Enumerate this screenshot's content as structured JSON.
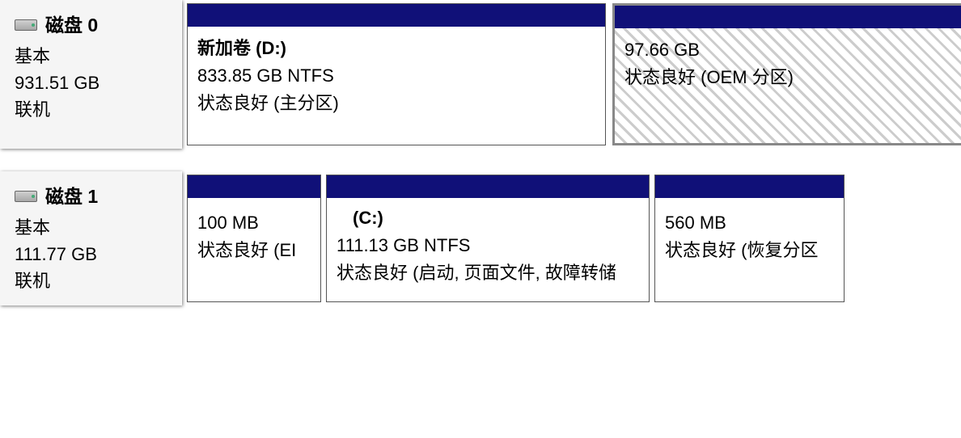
{
  "disks": [
    {
      "title": "磁盘 0",
      "type": "基本",
      "capacity": "931.51 GB",
      "status": "联机",
      "partitions": [
        {
          "name": "新加卷  (D:)",
          "size_fs": "833.85 GB NTFS",
          "status": "状态良好 (主分区)",
          "hatched": false
        },
        {
          "name": "",
          "size_fs": "97.66 GB",
          "status": "状态良好 (OEM 分区)",
          "hatched": true
        }
      ]
    },
    {
      "title": "磁盘 1",
      "type": "基本",
      "capacity": "111.77 GB",
      "status": "联机",
      "partitions": [
        {
          "name": "",
          "size_fs": "100 MB",
          "status": "状态良好 (EI",
          "hatched": false
        },
        {
          "name": "(C:)",
          "size_fs": "111.13 GB NTFS",
          "status": "状态良好 (启动, 页面文件, 故障转储",
          "hatched": false
        },
        {
          "name": "",
          "size_fs": "560 MB",
          "status": "状态良好 (恢复分区",
          "hatched": false
        }
      ]
    }
  ]
}
